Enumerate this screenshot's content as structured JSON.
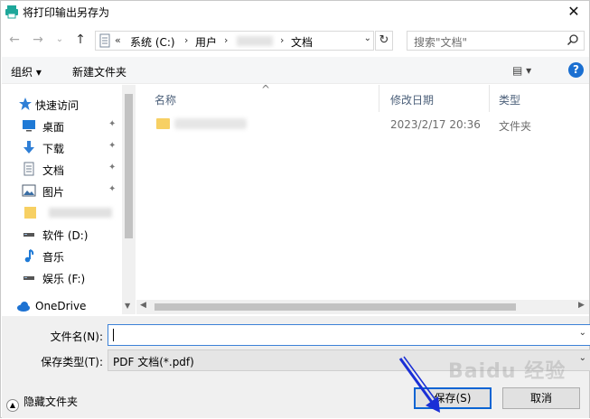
{
  "window": {
    "title": "将打印输出另存为",
    "close_glyph": "✕"
  },
  "nav": {
    "back_glyph": "←",
    "forward_glyph": "→",
    "history_glyph": "⌄",
    "up_glyph": "↑"
  },
  "address": {
    "overflow": "«",
    "crumbs": [
      "系统 (C:)",
      "用户",
      "文档"
    ],
    "separator": "›",
    "refresh_glyph": "↻"
  },
  "search": {
    "placeholder": "搜索\"文档\""
  },
  "toolbar": {
    "organize_label": "组织 ▾",
    "new_folder_label": "新建文件夹",
    "view_label": "▤ ▾",
    "help_label": "?"
  },
  "sidebar": {
    "items": [
      {
        "label": "快速访问",
        "icon": "star-icon"
      },
      {
        "label": "桌面",
        "icon": "desktop-icon",
        "pinned": true
      },
      {
        "label": "下载",
        "icon": "download-icon",
        "pinned": true
      },
      {
        "label": "文档",
        "icon": "document-icon",
        "pinned": true
      },
      {
        "label": "图片",
        "icon": "pictures-icon",
        "pinned": true
      },
      {
        "label": "软件 (D:)",
        "icon": "drive-icon"
      },
      {
        "label": "音乐",
        "icon": "music-icon"
      },
      {
        "label": "娱乐 (F:)",
        "icon": "drive-icon"
      },
      {
        "label": "OneDrive",
        "icon": "cloud-icon"
      }
    ],
    "pin_glyph": "📌"
  },
  "file_list": {
    "columns": [
      "名称",
      "修改日期",
      "类型"
    ],
    "sort_glyph": "^",
    "rows": [
      {
        "date": "2023/2/17 20:36",
        "type": "文件夹"
      }
    ]
  },
  "form": {
    "filename_label": "文件名(N):",
    "filename_value": "",
    "filetype_label": "保存类型(T):",
    "filetype_value": "PDF 文档(*.pdf)",
    "dropdown_glyph": "⌄",
    "hide_folders_label": "隐藏文件夹",
    "save_label": "保存(S)",
    "cancel_label": "取消"
  },
  "watermark": "Baidu 经验",
  "colors": {
    "accent": "#0a64d3",
    "folder": "#f7d063",
    "annotation_arrow": "#1a2fd6"
  }
}
